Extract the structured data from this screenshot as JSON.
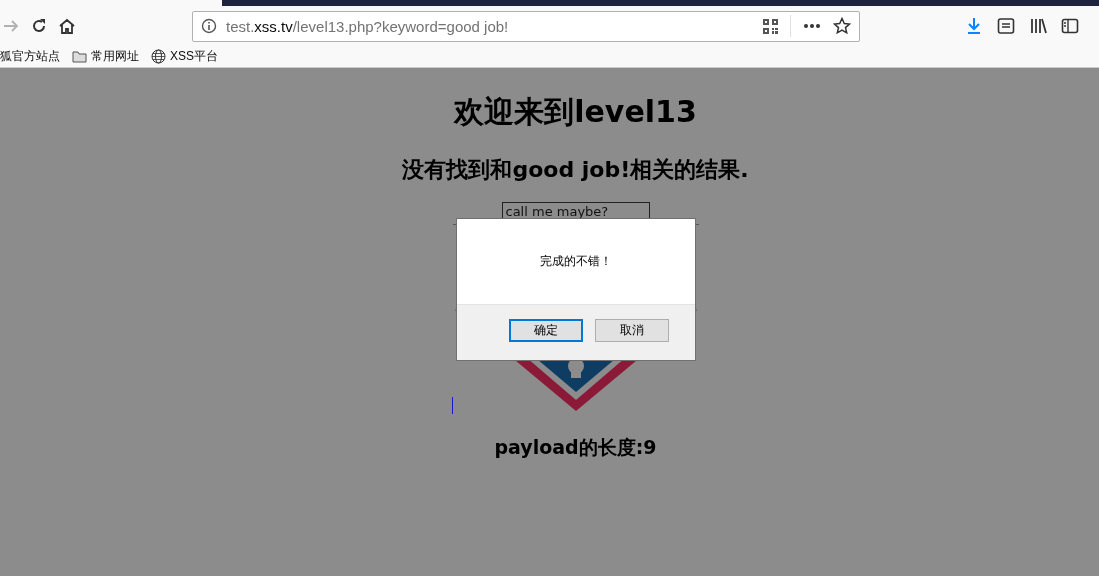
{
  "browser": {
    "url": [
      {
        "text": "test.",
        "emphasis": false
      },
      {
        "text": "xss.tv",
        "emphasis": true
      },
      {
        "text": "/level13.php?keyword=good job!",
        "emphasis": false
      }
    ],
    "bookmarks": [
      {
        "label": "狐官方站点",
        "kind": "page"
      },
      {
        "label": "常用网址",
        "kind": "folder"
      },
      {
        "label": "XSS平台",
        "kind": "globe"
      }
    ]
  },
  "page": {
    "title": "欢迎来到level13",
    "result": "没有找到和good job!相关的结果.",
    "input": {
      "value": "call me maybe?"
    },
    "payload_length": "payload的长度:9"
  },
  "dialog": {
    "message": "完成的不错！",
    "buttons": [
      {
        "label": "确定",
        "focused": true
      },
      {
        "label": "取消",
        "focused": false
      }
    ]
  }
}
